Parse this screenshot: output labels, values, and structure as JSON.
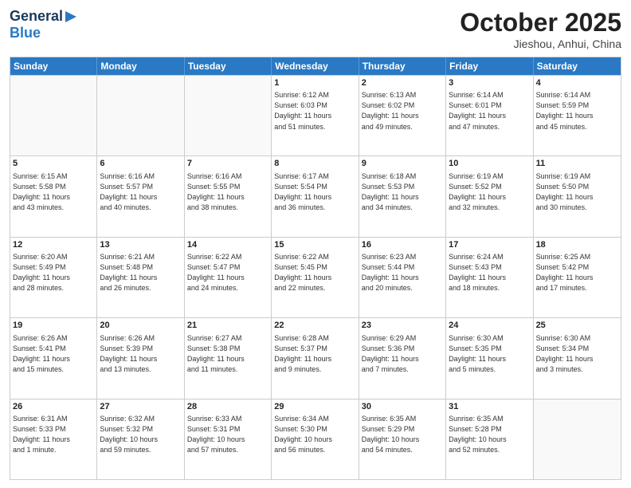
{
  "header": {
    "logo_general": "General",
    "logo_blue": "Blue",
    "month_title": "October 2025",
    "location": "Jieshou, Anhui, China"
  },
  "calendar": {
    "days_of_week": [
      "Sunday",
      "Monday",
      "Tuesday",
      "Wednesday",
      "Thursday",
      "Friday",
      "Saturday"
    ],
    "weeks": [
      [
        {
          "day": "",
          "content": "",
          "empty": true
        },
        {
          "day": "",
          "content": "",
          "empty": true
        },
        {
          "day": "",
          "content": "",
          "empty": true
        },
        {
          "day": "1",
          "content": "Sunrise: 6:12 AM\nSunset: 6:03 PM\nDaylight: 11 hours\nand 51 minutes.",
          "empty": false
        },
        {
          "day": "2",
          "content": "Sunrise: 6:13 AM\nSunset: 6:02 PM\nDaylight: 11 hours\nand 49 minutes.",
          "empty": false
        },
        {
          "day": "3",
          "content": "Sunrise: 6:14 AM\nSunset: 6:01 PM\nDaylight: 11 hours\nand 47 minutes.",
          "empty": false
        },
        {
          "day": "4",
          "content": "Sunrise: 6:14 AM\nSunset: 5:59 PM\nDaylight: 11 hours\nand 45 minutes.",
          "empty": false
        }
      ],
      [
        {
          "day": "5",
          "content": "Sunrise: 6:15 AM\nSunset: 5:58 PM\nDaylight: 11 hours\nand 43 minutes.",
          "empty": false
        },
        {
          "day": "6",
          "content": "Sunrise: 6:16 AM\nSunset: 5:57 PM\nDaylight: 11 hours\nand 40 minutes.",
          "empty": false
        },
        {
          "day": "7",
          "content": "Sunrise: 6:16 AM\nSunset: 5:55 PM\nDaylight: 11 hours\nand 38 minutes.",
          "empty": false
        },
        {
          "day": "8",
          "content": "Sunrise: 6:17 AM\nSunset: 5:54 PM\nDaylight: 11 hours\nand 36 minutes.",
          "empty": false
        },
        {
          "day": "9",
          "content": "Sunrise: 6:18 AM\nSunset: 5:53 PM\nDaylight: 11 hours\nand 34 minutes.",
          "empty": false
        },
        {
          "day": "10",
          "content": "Sunrise: 6:19 AM\nSunset: 5:52 PM\nDaylight: 11 hours\nand 32 minutes.",
          "empty": false
        },
        {
          "day": "11",
          "content": "Sunrise: 6:19 AM\nSunset: 5:50 PM\nDaylight: 11 hours\nand 30 minutes.",
          "empty": false
        }
      ],
      [
        {
          "day": "12",
          "content": "Sunrise: 6:20 AM\nSunset: 5:49 PM\nDaylight: 11 hours\nand 28 minutes.",
          "empty": false
        },
        {
          "day": "13",
          "content": "Sunrise: 6:21 AM\nSunset: 5:48 PM\nDaylight: 11 hours\nand 26 minutes.",
          "empty": false
        },
        {
          "day": "14",
          "content": "Sunrise: 6:22 AM\nSunset: 5:47 PM\nDaylight: 11 hours\nand 24 minutes.",
          "empty": false
        },
        {
          "day": "15",
          "content": "Sunrise: 6:22 AM\nSunset: 5:45 PM\nDaylight: 11 hours\nand 22 minutes.",
          "empty": false
        },
        {
          "day": "16",
          "content": "Sunrise: 6:23 AM\nSunset: 5:44 PM\nDaylight: 11 hours\nand 20 minutes.",
          "empty": false
        },
        {
          "day": "17",
          "content": "Sunrise: 6:24 AM\nSunset: 5:43 PM\nDaylight: 11 hours\nand 18 minutes.",
          "empty": false
        },
        {
          "day": "18",
          "content": "Sunrise: 6:25 AM\nSunset: 5:42 PM\nDaylight: 11 hours\nand 17 minutes.",
          "empty": false
        }
      ],
      [
        {
          "day": "19",
          "content": "Sunrise: 6:26 AM\nSunset: 5:41 PM\nDaylight: 11 hours\nand 15 minutes.",
          "empty": false
        },
        {
          "day": "20",
          "content": "Sunrise: 6:26 AM\nSunset: 5:39 PM\nDaylight: 11 hours\nand 13 minutes.",
          "empty": false
        },
        {
          "day": "21",
          "content": "Sunrise: 6:27 AM\nSunset: 5:38 PM\nDaylight: 11 hours\nand 11 minutes.",
          "empty": false
        },
        {
          "day": "22",
          "content": "Sunrise: 6:28 AM\nSunset: 5:37 PM\nDaylight: 11 hours\nand 9 minutes.",
          "empty": false
        },
        {
          "day": "23",
          "content": "Sunrise: 6:29 AM\nSunset: 5:36 PM\nDaylight: 11 hours\nand 7 minutes.",
          "empty": false
        },
        {
          "day": "24",
          "content": "Sunrise: 6:30 AM\nSunset: 5:35 PM\nDaylight: 11 hours\nand 5 minutes.",
          "empty": false
        },
        {
          "day": "25",
          "content": "Sunrise: 6:30 AM\nSunset: 5:34 PM\nDaylight: 11 hours\nand 3 minutes.",
          "empty": false
        }
      ],
      [
        {
          "day": "26",
          "content": "Sunrise: 6:31 AM\nSunset: 5:33 PM\nDaylight: 11 hours\nand 1 minute.",
          "empty": false
        },
        {
          "day": "27",
          "content": "Sunrise: 6:32 AM\nSunset: 5:32 PM\nDaylight: 10 hours\nand 59 minutes.",
          "empty": false
        },
        {
          "day": "28",
          "content": "Sunrise: 6:33 AM\nSunset: 5:31 PM\nDaylight: 10 hours\nand 57 minutes.",
          "empty": false
        },
        {
          "day": "29",
          "content": "Sunrise: 6:34 AM\nSunset: 5:30 PM\nDaylight: 10 hours\nand 56 minutes.",
          "empty": false
        },
        {
          "day": "30",
          "content": "Sunrise: 6:35 AM\nSunset: 5:29 PM\nDaylight: 10 hours\nand 54 minutes.",
          "empty": false
        },
        {
          "day": "31",
          "content": "Sunrise: 6:35 AM\nSunset: 5:28 PM\nDaylight: 10 hours\nand 52 minutes.",
          "empty": false
        },
        {
          "day": "",
          "content": "",
          "empty": true
        }
      ]
    ]
  }
}
